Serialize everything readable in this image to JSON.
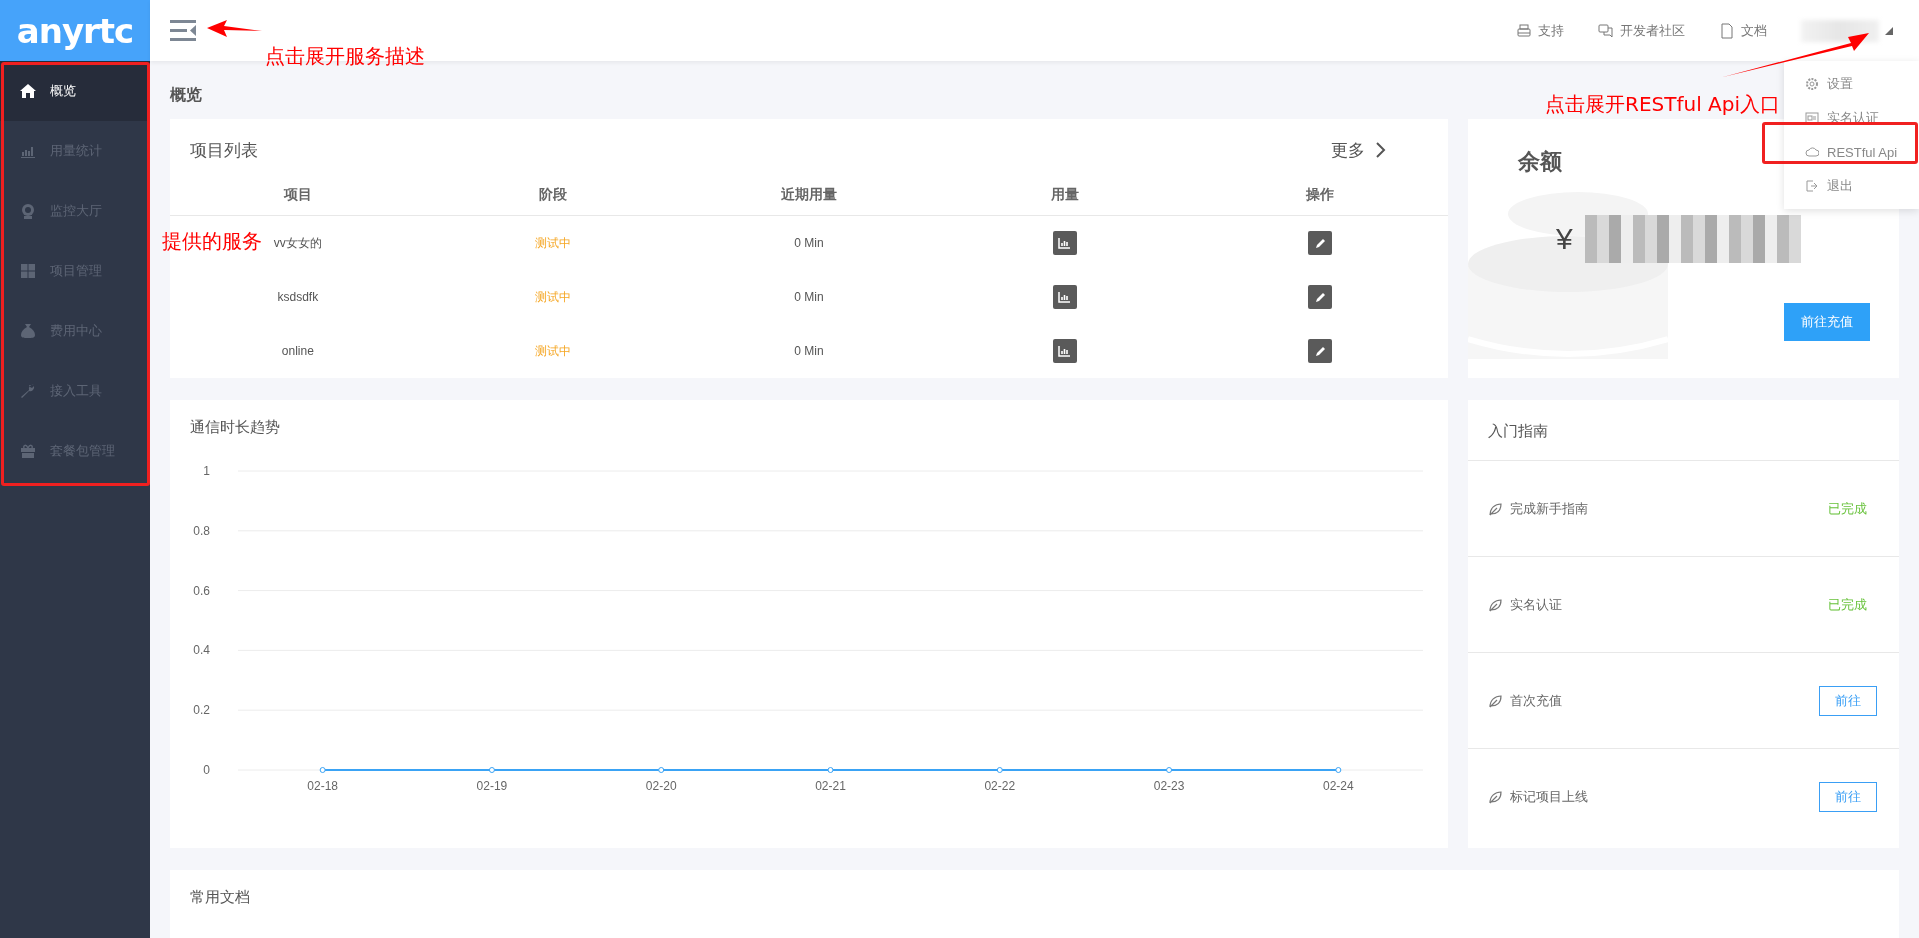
{
  "logo": "anyrtc",
  "sidebar": {
    "items": [
      {
        "label": "概览",
        "selected": true
      },
      {
        "label": "用量统计",
        "selected": false
      },
      {
        "label": "监控大厅",
        "selected": false
      },
      {
        "label": "项目管理",
        "selected": false
      },
      {
        "label": "费用中心",
        "selected": false
      },
      {
        "label": "接入工具",
        "selected": false
      },
      {
        "label": "套餐包管理",
        "selected": false
      }
    ]
  },
  "topbar": {
    "links": [
      {
        "label": "支持"
      },
      {
        "label": "开发者社区"
      },
      {
        "label": "文档"
      }
    ]
  },
  "user_menu": {
    "items": [
      {
        "label": "设置"
      },
      {
        "label": "实名认证"
      },
      {
        "label": "RESTful Api"
      },
      {
        "label": "退出"
      }
    ]
  },
  "page_title": "概览",
  "projects": {
    "title": "项目列表",
    "more": "更多",
    "columns": [
      "项目",
      "阶段",
      "近期用量",
      "用量",
      "操作"
    ],
    "rows": [
      {
        "name": "vv女女的",
        "stage": "测试中",
        "recent_usage": "0 Min"
      },
      {
        "name": "ksdsdfk",
        "stage": "测试中",
        "recent_usage": "0 Min"
      },
      {
        "name": "online",
        "stage": "测试中",
        "recent_usage": "0 Min"
      }
    ]
  },
  "balance": {
    "title": "余额",
    "currency": "¥",
    "button": "前往充值"
  },
  "trend": {
    "title": "通信时长趋势",
    "chart_data": {
      "type": "line",
      "categories": [
        "02-18",
        "02-19",
        "02-20",
        "02-21",
        "02-22",
        "02-23",
        "02-24"
      ],
      "series": [
        {
          "color": "#3aa3f5",
          "marker": true,
          "values": [
            0,
            0,
            0,
            0,
            0,
            0,
            0
          ]
        }
      ],
      "grid": true,
      "ylim": [
        0,
        1
      ],
      "yticks": [
        0,
        0.2,
        0.4,
        0.6,
        0.8,
        1
      ]
    }
  },
  "guide": {
    "title": "入门指南",
    "items": [
      {
        "label": "完成新手指南",
        "kind": "done",
        "status": "已完成"
      },
      {
        "label": "实名认证",
        "kind": "done",
        "status": "已完成"
      },
      {
        "label": "首次充值",
        "kind": "action",
        "action": "前往"
      },
      {
        "label": "标记项目上线",
        "kind": "action",
        "action": "前往"
      }
    ]
  },
  "docs": {
    "title": "常用文档"
  },
  "annotations": [
    {
      "text": "点击展开服务描述"
    },
    {
      "text": "提供的服务"
    },
    {
      "text": "点击展开RESTful Api入口"
    }
  ]
}
